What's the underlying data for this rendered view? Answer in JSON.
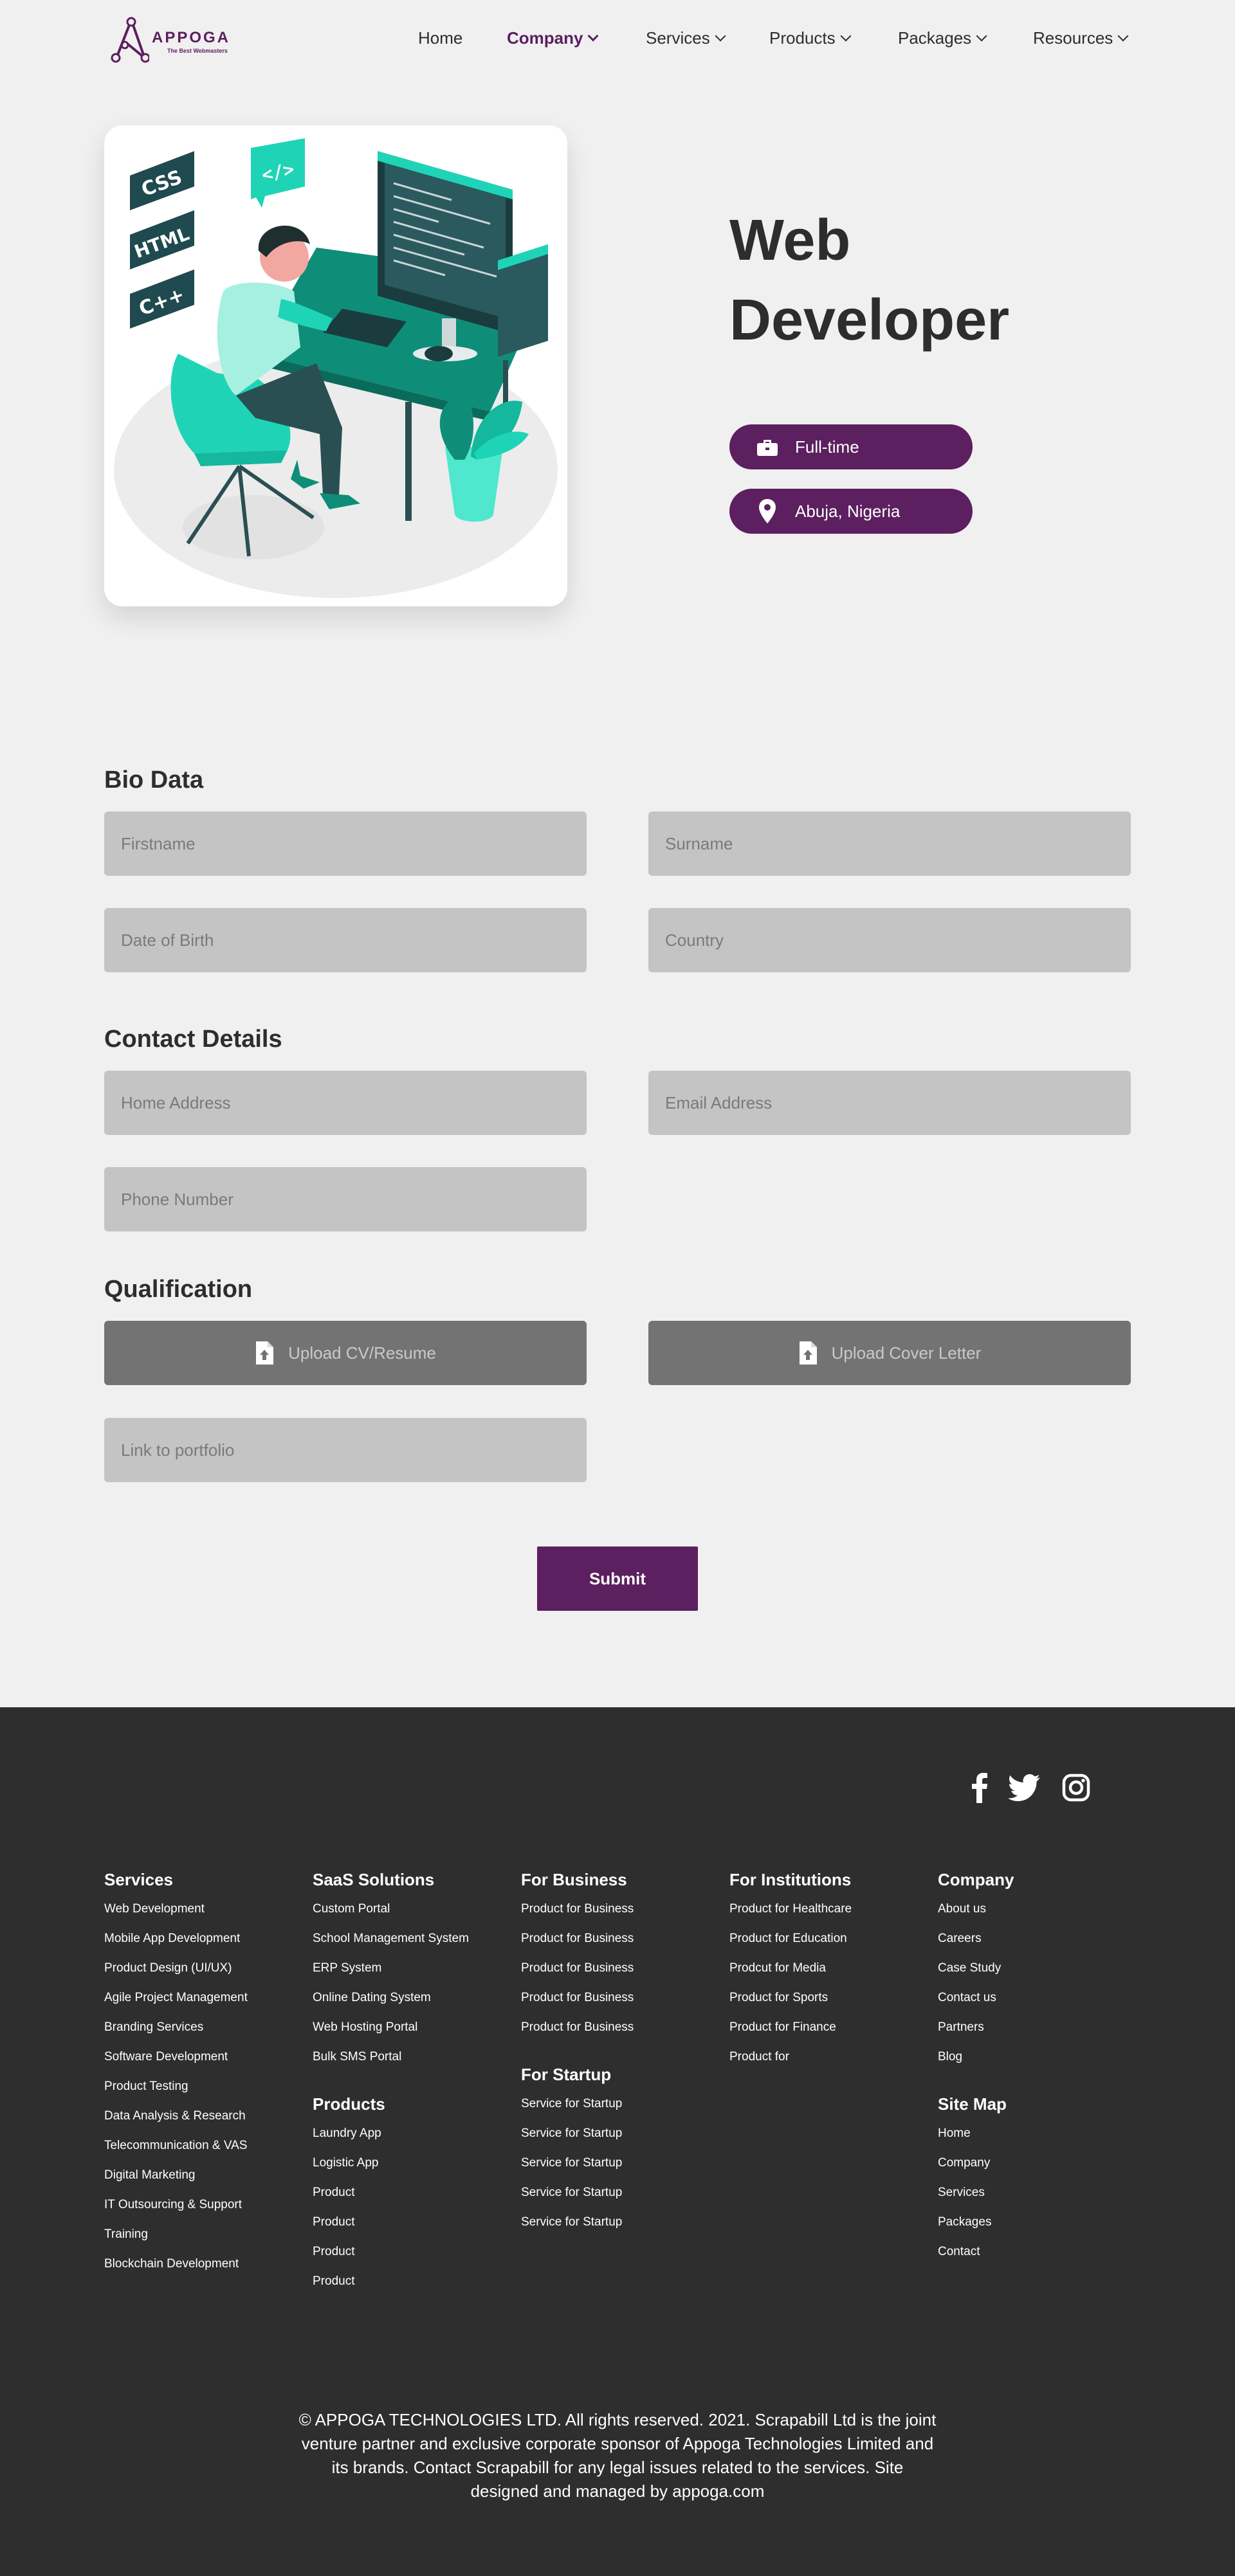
{
  "brand": {
    "name": "APPOGA",
    "tagline": "The Best Webmasters",
    "accent": "#5c1f5f"
  },
  "nav": {
    "items": [
      {
        "label": "Home"
      },
      {
        "label": "Company"
      },
      {
        "label": "Services"
      },
      {
        "label": "Products"
      },
      {
        "label": "Packages"
      },
      {
        "label": "Resources"
      }
    ],
    "active": "Company"
  },
  "hero": {
    "title": "Web Developer",
    "illustration_labels": [
      "CSS",
      "HTML",
      "C++",
      "</>"
    ],
    "pills": [
      {
        "icon": "briefcase-icon",
        "text": "Full-time"
      },
      {
        "icon": "location-pin-icon",
        "text": "Abuja, Nigeria"
      }
    ]
  },
  "form": {
    "bio": {
      "title": "Bio Data",
      "firstname": "Firstname",
      "surname": "Surname",
      "dob": "Date of Birth",
      "country": "Country"
    },
    "contact": {
      "title": "Contact Details",
      "address": "Home Address",
      "email": "Email Address",
      "phone": "Phone Number"
    },
    "qualification": {
      "title": "Qualification",
      "upload_cv": "Upload CV/Resume",
      "upload_cover": "Upload Cover Letter",
      "portfolio": "Link to portfolio"
    },
    "submit": "Submit"
  },
  "footer": {
    "social": [
      "facebook-icon",
      "twitter-icon",
      "instagram-icon"
    ],
    "services": {
      "title": "Services",
      "links": [
        "Web Development",
        "Mobile App Development",
        "Product Design (UI/UX)",
        "Agile Project Management",
        "Branding Services",
        "Software Development",
        "Product Testing",
        "Data Analysis & Research",
        "Telecommunication & VAS",
        "Digital Marketing",
        "IT Outsourcing & Support",
        "Training",
        "Blockchain Development"
      ]
    },
    "saas": {
      "title": "SaaS Solutions",
      "links": [
        "Custom Portal",
        "School Management System",
        "ERP System",
        "Online Dating System",
        "Web Hosting Portal",
        "Bulk SMS Portal"
      ]
    },
    "products": {
      "title": "Products",
      "links": [
        "Laundry App",
        "Logistic App",
        "Product",
        "Product",
        "Product",
        "Product"
      ]
    },
    "business": {
      "title": "For Business",
      "links": [
        "Product for Business",
        "Product for Business",
        "Product for Business",
        "Product for Business",
        "Product for Business"
      ]
    },
    "startup": {
      "title": "For Startup",
      "links": [
        "Service for Startup",
        "Service for Startup",
        "Service for Startup",
        "Service for Startup",
        "Service for Startup"
      ]
    },
    "institutions": {
      "title": "For Institutions",
      "links": [
        "Product for Healthcare",
        "Product for Education",
        "Prodcut for Media",
        "Product for Sports",
        "Product for Finance",
        "Product for"
      ]
    },
    "company": {
      "title": "Company",
      "links": [
        "About us",
        "Careers",
        "Case Study",
        "Contact us",
        "Partners",
        "Blog"
      ]
    },
    "sitemap": {
      "title": "Site Map",
      "links": [
        "Home",
        "Company",
        "Services",
        "Packages",
        "Contact"
      ]
    },
    "copyright": "© APPOGA TECHNOLOGIES LTD. All rights reserved. 2021. Scrapabill Ltd is the joint venture partner and exclusive corporate sponsor of Appoga Technologies Limited and its brands. Contact Scrapabill for any legal issues related to the services. Site designed and managed by appoga.com"
  }
}
